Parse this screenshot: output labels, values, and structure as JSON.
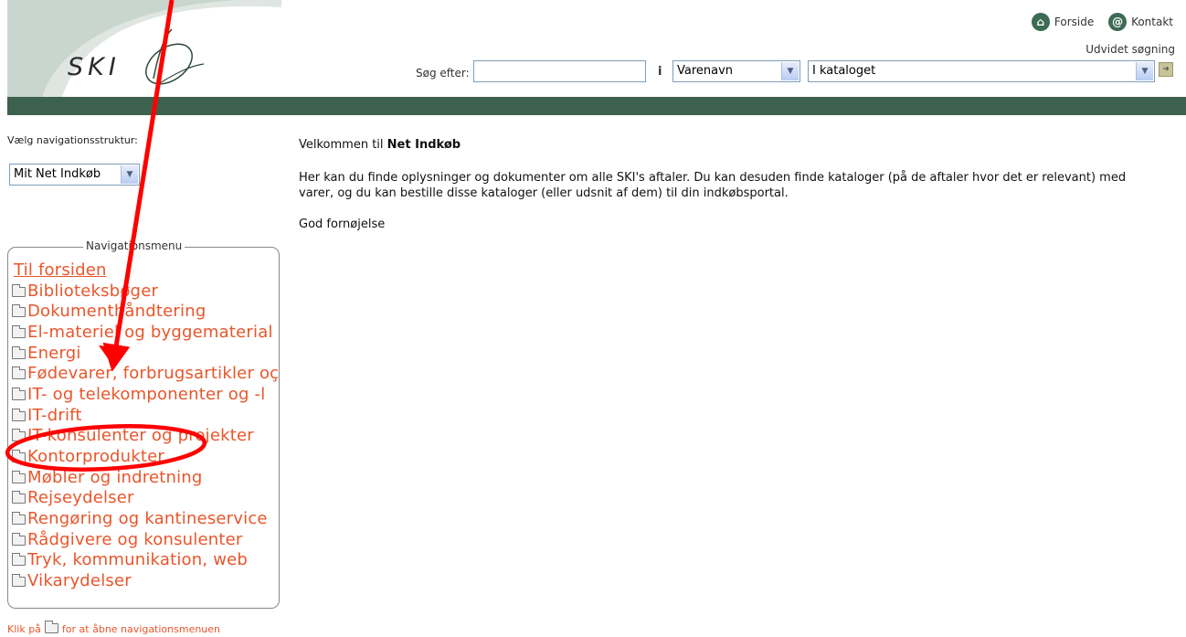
{
  "header": {
    "logo_text": "SKI",
    "links": [
      {
        "label": "Forside",
        "icon": "home-icon"
      },
      {
        "label": "Kontakt",
        "icon": "at-icon"
      }
    ],
    "advanced_search": "Udvidet søgning",
    "search": {
      "label": "Søg efter:",
      "value": "",
      "in_label": "i",
      "field_select": "Varenavn",
      "scope_select": "I kataloget"
    },
    "colors": {
      "bar": "#3c614d",
      "link": "#e8562b"
    }
  },
  "sidebar": {
    "nav_structure_label": "Vælg navigationsstruktur:",
    "nav_structure_value": "Mit Net Indkøb",
    "menu_title": "Navigationsmenu",
    "home_link": "Til forsiden",
    "items": [
      {
        "label": "Biblioteksbøger"
      },
      {
        "label": "Dokumenthåndtering"
      },
      {
        "label": "El-materiel og byggematerial"
      },
      {
        "label": "Energi"
      },
      {
        "label": "Fødevarer, forbrugsartikler oç"
      },
      {
        "label": "IT- og telekomponenter og -l"
      },
      {
        "label": "IT-drift"
      },
      {
        "label": "IT-konsulenter og projekter"
      },
      {
        "label": "Kontorprodukter"
      },
      {
        "label": "Møbler og indretning"
      },
      {
        "label": "Rejseydelser"
      },
      {
        "label": "Rengøring og kantineservice"
      },
      {
        "label": "Rådgivere og konsulenter"
      },
      {
        "label": "Tryk, kommunikation, web"
      },
      {
        "label": "Vikarydelser"
      }
    ],
    "hint_before": "Klik på",
    "hint_after": "for at åbne navigationsmenuen"
  },
  "main": {
    "welcome_prefix": "Velkommen til ",
    "welcome_bold": "Net Indkøb",
    "intro": "Her kan du finde oplysninger og dokumenter om alle SKI's aftaler. Du kan desuden finde kataloger (på de aftaler hvor det er relevant) med varer, og du kan bestille disse kataloger (eller udsnit af dem) til din indkøbsportal.",
    "closing": "God fornøjelse"
  },
  "annotation": {
    "color": "#ff0000",
    "highlighted_item": "Kontorprodukter"
  }
}
